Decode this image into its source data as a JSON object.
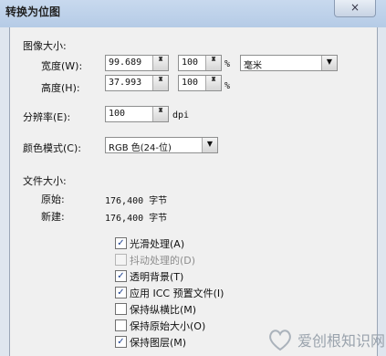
{
  "window": {
    "title": "转换为位图",
    "close_glyph": "×"
  },
  "image_size": {
    "section_label": "图像大小:",
    "width": {
      "label": "宽度(W):",
      "value": "99.689",
      "percent": "100",
      "percent_unit": "%"
    },
    "height": {
      "label": "高度(H):",
      "value": "37.993",
      "percent": "100",
      "percent_unit": "%"
    },
    "unit": "毫米"
  },
  "resolution": {
    "label": "分辨率(E):",
    "value": "100",
    "unit": "dpi"
  },
  "color_mode": {
    "label": "颜色模式(C):",
    "value": "RGB 色(24-位)"
  },
  "file_size": {
    "section_label": "文件大小:",
    "original_label": "原始:",
    "original_value": "176,400 字节",
    "new_label": "新建:",
    "new_value": "176,400 字节"
  },
  "options": [
    {
      "label": "光滑处理(A)",
      "checked": true,
      "enabled": true
    },
    {
      "label": "抖动处理的(D)",
      "checked": false,
      "enabled": false
    },
    {
      "label": "透明背景(T)",
      "checked": true,
      "enabled": true
    },
    {
      "label": "应用 ICC 预置文件(I)",
      "checked": true,
      "enabled": true
    },
    {
      "label": "保持纵横比(M)",
      "checked": false,
      "enabled": true
    },
    {
      "label": "保持原始大小(O)",
      "checked": false,
      "enabled": true
    },
    {
      "label": "保持图层(M)",
      "checked": true,
      "enabled": true
    }
  ],
  "watermark": {
    "text": "爱创根知识网"
  },
  "icons": {
    "spin": "up-down-arrows",
    "dropdown": "chevron-down-icon",
    "check": "✓"
  }
}
